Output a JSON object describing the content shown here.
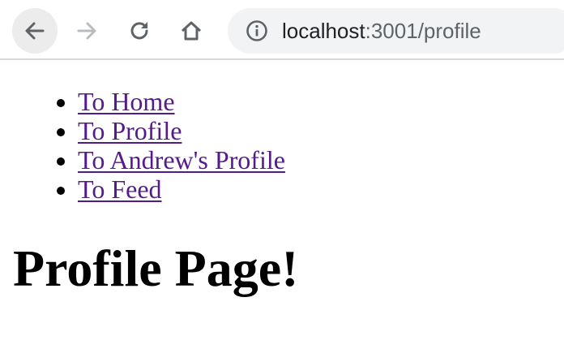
{
  "browser": {
    "url_host": "localhost",
    "url_rest": ":3001/profile",
    "icons": {
      "back": "back-arrow-icon",
      "forward": "forward-arrow-icon",
      "reload": "reload-icon",
      "home": "home-icon",
      "site_info": "info-icon"
    }
  },
  "nav": {
    "links": [
      {
        "label": "To Home"
      },
      {
        "label": "To Profile"
      },
      {
        "label": "To Andrew's Profile"
      },
      {
        "label": "To Feed"
      }
    ]
  },
  "main": {
    "title": "Profile Page!"
  },
  "colors": {
    "link_visited": "#551a8b",
    "omnibox_bg": "#f1f3f4",
    "toolbar_border": "#d9d9d9"
  }
}
